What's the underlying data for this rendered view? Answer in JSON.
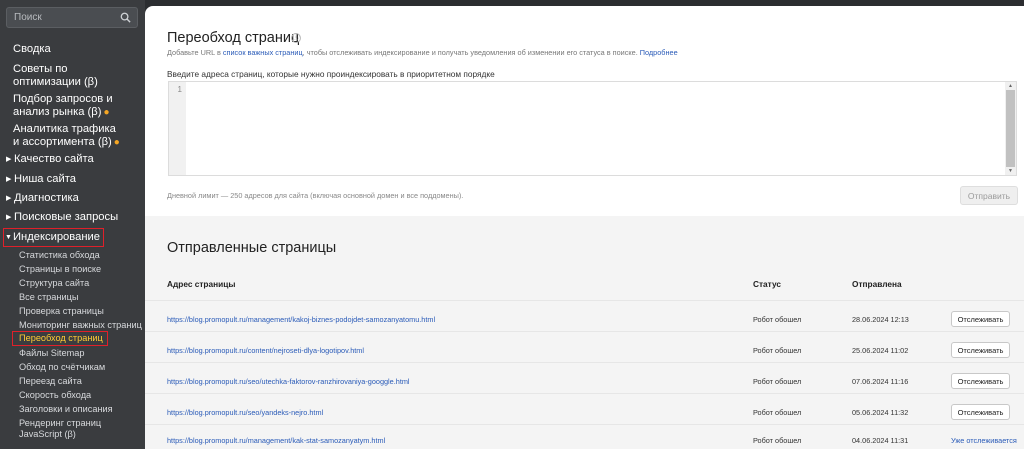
{
  "search": {
    "placeholder": "Поиск"
  },
  "sidebar": {
    "top_items": [
      {
        "label": "Сводка"
      },
      {
        "label": "Советы по оптимизации (β)"
      },
      {
        "label": "Подбор запросов и анализ рынка (β)",
        "dot": "●"
      },
      {
        "label": "Аналитика трафика и ассортимента (β)",
        "dot": "●"
      }
    ],
    "groups": [
      {
        "label": "Качество сайта",
        "arrow": "▶"
      },
      {
        "label": "Ниша сайта",
        "arrow": "▶"
      },
      {
        "label": "Диагностика",
        "arrow": "▶"
      },
      {
        "label": "Поисковые запросы",
        "arrow": "▶"
      },
      {
        "label": "Индексирование",
        "arrow": "▼"
      }
    ],
    "sub_items": [
      {
        "label": "Статистика обхода"
      },
      {
        "label": "Страницы в поиске"
      },
      {
        "label": "Структура сайта"
      },
      {
        "label": "Все страницы"
      },
      {
        "label": "Проверка страницы"
      },
      {
        "label": "Мониторинг важных страниц"
      },
      {
        "label": "Переобход страниц"
      },
      {
        "label": "Файлы Sitemap"
      },
      {
        "label": "Обход по счётчикам"
      },
      {
        "label": "Переезд сайта"
      },
      {
        "label": "Скорость обхода"
      },
      {
        "label": "Заголовки и описания"
      },
      {
        "label": "Рендеринг страниц JavaScript (β)"
      }
    ],
    "accent_color": "#f5a623",
    "highlight_color": "#e0202a"
  },
  "recrawl": {
    "title": "Переобход страниц",
    "info_icon": "ⓘ",
    "subtitle_before": "Добавьте URL в ",
    "subtitle_link": "список важных страниц",
    "subtitle_after": ", чтобы отслеживать индексирование и получать уведомления об изменении его статуса в поиске.",
    "more_link": "Подробнее",
    "textarea_label": "Введите адреса страниц, которые нужно проиндексировать в приоритетном порядке",
    "line_number": "1",
    "textarea_value": "",
    "limit_text": "Дневной лимит — 250 адресов для сайта (включая основной домен и все поддомены).",
    "send_label": "Отправить"
  },
  "sent": {
    "title": "Отправленные страницы",
    "headers": {
      "url": "Адрес страницы",
      "status": "Статус",
      "date": "Отправлена"
    },
    "rows": [
      {
        "url": "https://blog.promopult.ru/management/kakoj-biznes-podojdet-samozanyatomu.html",
        "status": "Робот обошел",
        "date": "28.06.2024 12:13",
        "action": "Отслеживать"
      },
      {
        "url": "https://blog.promopult.ru/content/nejroseti-dlya-logotipov.html",
        "status": "Робот обошел",
        "date": "25.06.2024 11:02",
        "action": "Отслеживать"
      },
      {
        "url": "https://blog.promopult.ru/seo/utechka-faktorov-ranzhirovaniya-googgle.html",
        "status": "Робот обошел",
        "date": "07.06.2024 11:16",
        "action": "Отслеживать"
      },
      {
        "url": "https://blog.promopult.ru/seo/yandeks-nejro.html",
        "status": "Робот обошел",
        "date": "05.06.2024 11:32",
        "action": "Отслеживать"
      },
      {
        "url": "https://blog.promopult.ru/management/kak-stat-samozanyatym.html",
        "status": "Робот обошел",
        "date": "04.06.2024 11:31",
        "action": "Уже отслеживается"
      }
    ]
  }
}
